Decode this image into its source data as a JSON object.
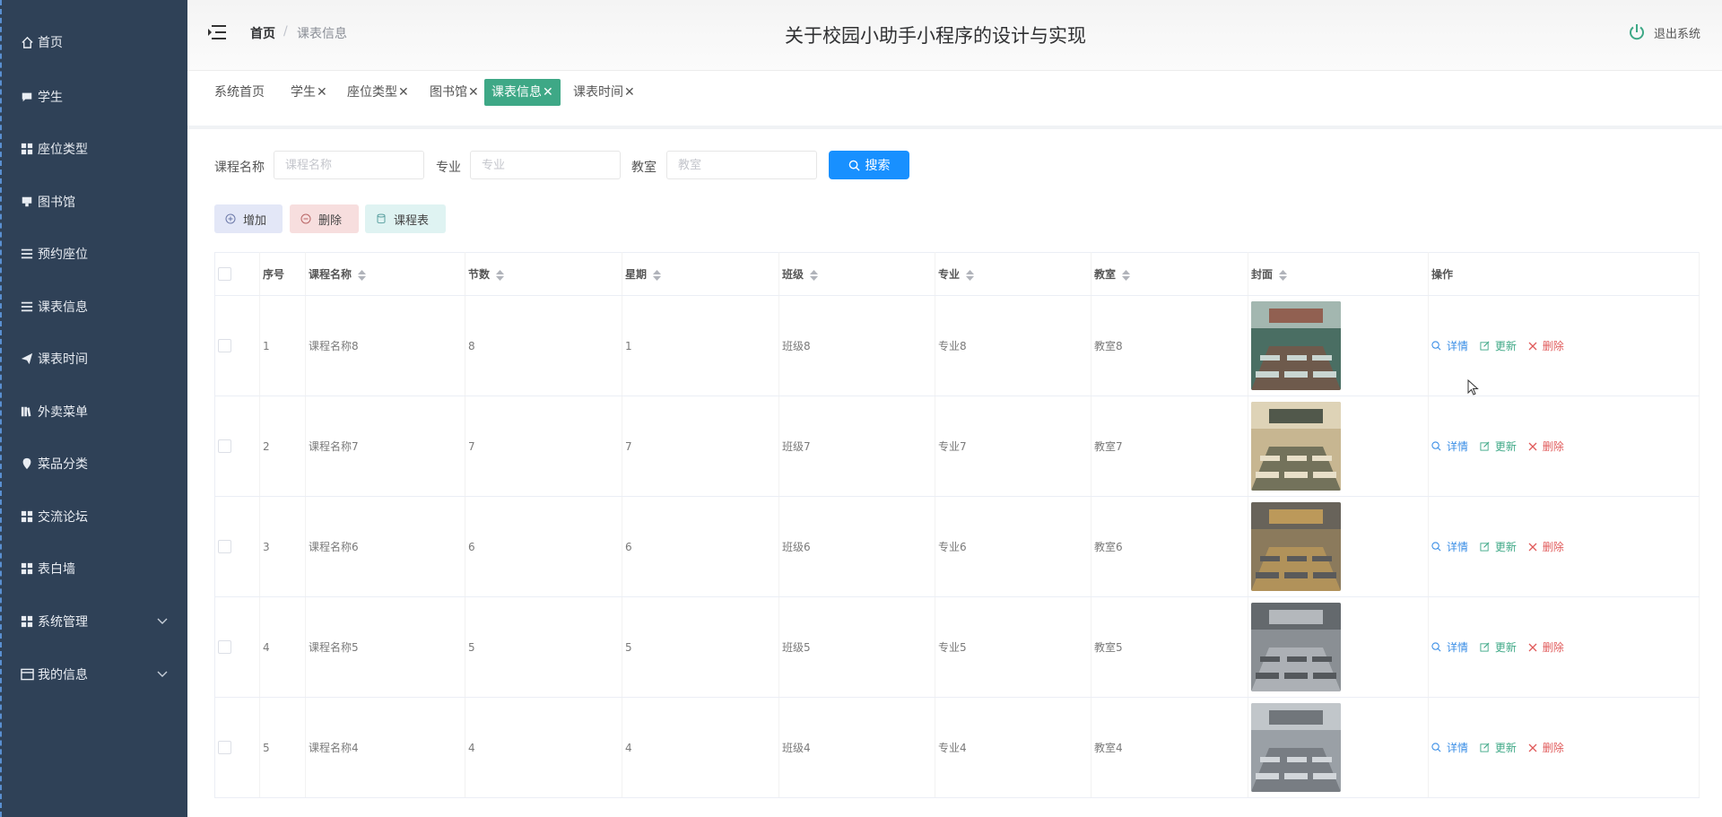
{
  "sidebar": {
    "items": [
      {
        "label": "首页",
        "icon": "home-icon"
      },
      {
        "label": "学生",
        "icon": "chat-icon"
      },
      {
        "label": "座位类型",
        "icon": "grid-icon"
      },
      {
        "label": "图书馆",
        "icon": "stamp-icon"
      },
      {
        "label": "预约座位",
        "icon": "list-icon"
      },
      {
        "label": "课表信息",
        "icon": "list-icon"
      },
      {
        "label": "课表时间",
        "icon": "send-icon"
      },
      {
        "label": "外卖菜单",
        "icon": "books-icon"
      },
      {
        "label": "菜品分类",
        "icon": "location-icon"
      },
      {
        "label": "交流论坛",
        "icon": "grid-icon"
      },
      {
        "label": "表白墙",
        "icon": "grid-icon"
      },
      {
        "label": "系统管理",
        "icon": "grid-icon"
      },
      {
        "label": "我的信息",
        "icon": "card-icon"
      }
    ]
  },
  "header": {
    "breadcrumb_home": "首页",
    "breadcrumb_sep": "/",
    "breadcrumb_current": "课表信息",
    "title": "关于校园小助手小程序的设计与实现",
    "logout": "退出系统"
  },
  "tabs": [
    {
      "label": "系统首页",
      "closable": false
    },
    {
      "label": "学生",
      "closable": true
    },
    {
      "label": "座位类型",
      "closable": true
    },
    {
      "label": "图书馆",
      "closable": true
    },
    {
      "label": "课表信息",
      "closable": true,
      "active": true
    },
    {
      "label": "课表时间",
      "closable": true
    }
  ],
  "search": {
    "course_label": "课程名称",
    "course_placeholder": "课程名称",
    "major_label": "专业",
    "major_placeholder": "专业",
    "room_label": "教室",
    "room_placeholder": "教室",
    "button": "搜索"
  },
  "actions": {
    "add": "增加",
    "delete": "删除",
    "schedule": "课程表"
  },
  "table": {
    "headers": [
      "序号",
      "课程名称",
      "节数",
      "星期",
      "班级",
      "专业",
      "教室",
      "封面",
      "操作"
    ],
    "op_detail": "详情",
    "op_update": "更新",
    "op_delete": "删除",
    "rows": [
      {
        "idx": "1",
        "name": "课程名称8",
        "period": "8",
        "weekday": "1",
        "cls": "班级8",
        "major": "专业8",
        "room": "教室8"
      },
      {
        "idx": "2",
        "name": "课程名称7",
        "period": "7",
        "weekday": "7",
        "cls": "班级7",
        "major": "专业7",
        "room": "教室7"
      },
      {
        "idx": "3",
        "name": "课程名称6",
        "period": "6",
        "weekday": "6",
        "cls": "班级6",
        "major": "专业6",
        "room": "教室6"
      },
      {
        "idx": "4",
        "name": "课程名称5",
        "period": "5",
        "weekday": "5",
        "cls": "班级5",
        "major": "专业5",
        "room": "教室5"
      },
      {
        "idx": "5",
        "name": "课程名称4",
        "period": "4",
        "weekday": "4",
        "cls": "班级4",
        "major": "专业4",
        "room": "教室4"
      }
    ]
  },
  "colors": {
    "sidebar": "#2f4157",
    "accent": "#3ea886",
    "primary": "#1890ff",
    "danger": "#e05a5a"
  }
}
